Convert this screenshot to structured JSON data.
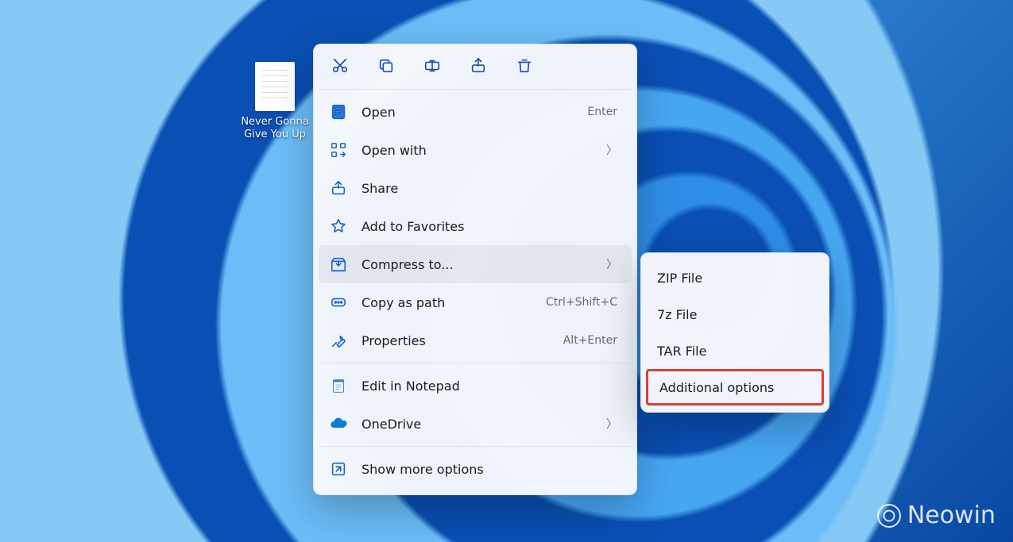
{
  "desktop": {
    "file_label": "Never Gonna Give You Up"
  },
  "toolbar": {
    "cut": "cut-icon",
    "copy": "copy-icon",
    "rename": "rename-icon",
    "share": "share-icon",
    "delete": "delete-icon"
  },
  "menu": {
    "open": {
      "label": "Open",
      "shortcut": "Enter"
    },
    "open_with": {
      "label": "Open with"
    },
    "share": {
      "label": "Share"
    },
    "favorites": {
      "label": "Add to Favorites"
    },
    "compress": {
      "label": "Compress to..."
    },
    "copy_path": {
      "label": "Copy as path",
      "shortcut": "Ctrl+Shift+C"
    },
    "properties": {
      "label": "Properties",
      "shortcut": "Alt+Enter"
    },
    "edit_notepad": {
      "label": "Edit in Notepad"
    },
    "onedrive": {
      "label": "OneDrive"
    },
    "more": {
      "label": "Show more options"
    }
  },
  "submenu": {
    "zip": "ZIP File",
    "sevenz": "7z File",
    "tar": "TAR File",
    "additional": "Additional options"
  },
  "watermark": {
    "text": "Neowin"
  }
}
